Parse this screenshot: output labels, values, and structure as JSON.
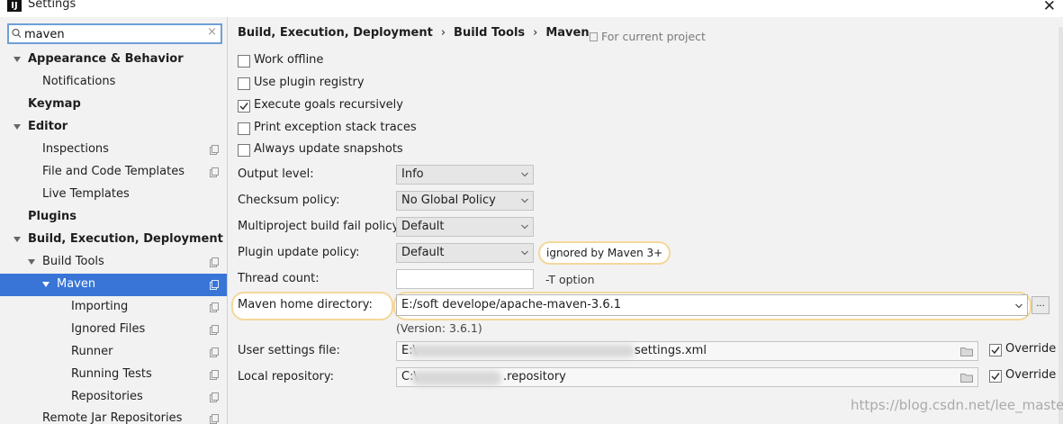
{
  "window": {
    "title": "Settings",
    "logo": "IJ"
  },
  "search": {
    "value": "maven",
    "clear": "×"
  },
  "sidebar": {
    "items": [
      {
        "label": "Appearance & Behavior"
      },
      {
        "label": "Notifications"
      },
      {
        "label": "Keymap"
      },
      {
        "label": "Editor"
      },
      {
        "label": "Inspections"
      },
      {
        "label": "File and Code Templates"
      },
      {
        "label": "Live Templates"
      },
      {
        "label": "Plugins"
      },
      {
        "label": "Build, Execution, Deployment"
      },
      {
        "label": "Build Tools"
      },
      {
        "label": "Maven"
      },
      {
        "label": "Importing"
      },
      {
        "label": "Ignored Files"
      },
      {
        "label": "Runner"
      },
      {
        "label": "Running Tests"
      },
      {
        "label": "Repositories"
      },
      {
        "label": "Remote Jar Repositories"
      }
    ]
  },
  "breadcrumb": {
    "items": [
      "Build, Execution, Deployment",
      "Build Tools",
      "Maven"
    ],
    "separator": "›",
    "scope": "For current project"
  },
  "options": {
    "work_offline": {
      "label": "Work offline",
      "checked": false
    },
    "use_plugin_registry": {
      "label": "Use plugin registry",
      "checked": false
    },
    "execute_goals_recursively": {
      "label": "Execute goals recursively",
      "checked": true
    },
    "print_exception_stack_traces": {
      "label": "Print exception stack traces",
      "checked": false
    },
    "always_update_snapshots": {
      "label": "Always update snapshots",
      "checked": false
    }
  },
  "form": {
    "output_level": {
      "label": "Output level:",
      "value": "Info"
    },
    "checksum_policy": {
      "label": "Checksum policy:",
      "value": "No Global Policy"
    },
    "multiproject_fail_policy": {
      "label": "Multiproject build fail policy:",
      "value": "Default"
    },
    "plugin_update_policy": {
      "label": "Plugin update policy:",
      "value": "Default",
      "note": "ignored by Maven 3+"
    },
    "thread_count": {
      "label": "Thread count:",
      "value": "",
      "hint": "-T option"
    },
    "maven_home": {
      "label": "Maven home directory:",
      "value": "E:/soft develope/apache-maven-3.6.1",
      "browse": "...",
      "version": "(Version: 3.6.1)"
    },
    "user_settings": {
      "label": "User settings file:",
      "value_prefix": "E:\\",
      "value_suffix": "settings.xml",
      "override": "Override",
      "override_checked": true
    },
    "local_repository": {
      "label": "Local repository:",
      "value_prefix": "C:\\",
      "value_suffix": ".repository",
      "override": "Override",
      "override_checked": true
    }
  },
  "watermark": "https://blog.csdn.net/lee_master",
  "colors": {
    "selection": "#3875d7",
    "highlight": "#f4d79a",
    "focus": "#6f9fd8"
  }
}
